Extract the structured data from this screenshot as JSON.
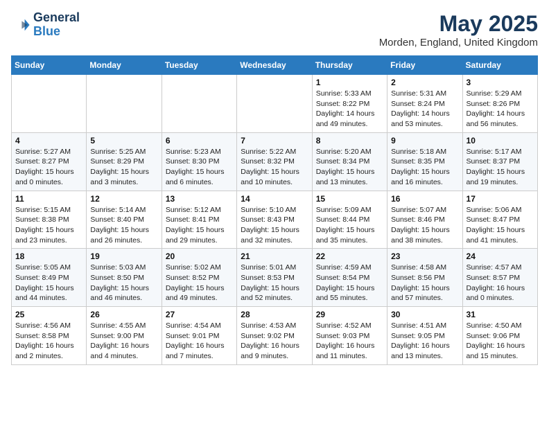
{
  "header": {
    "logo_line1": "General",
    "logo_line2": "Blue",
    "month": "May 2025",
    "location": "Morden, England, United Kingdom"
  },
  "weekdays": [
    "Sunday",
    "Monday",
    "Tuesday",
    "Wednesday",
    "Thursday",
    "Friday",
    "Saturday"
  ],
  "weeks": [
    [
      {
        "day": "",
        "info": ""
      },
      {
        "day": "",
        "info": ""
      },
      {
        "day": "",
        "info": ""
      },
      {
        "day": "",
        "info": ""
      },
      {
        "day": "1",
        "info": "Sunrise: 5:33 AM\nSunset: 8:22 PM\nDaylight: 14 hours\nand 49 minutes."
      },
      {
        "day": "2",
        "info": "Sunrise: 5:31 AM\nSunset: 8:24 PM\nDaylight: 14 hours\nand 53 minutes."
      },
      {
        "day": "3",
        "info": "Sunrise: 5:29 AM\nSunset: 8:26 PM\nDaylight: 14 hours\nand 56 minutes."
      }
    ],
    [
      {
        "day": "4",
        "info": "Sunrise: 5:27 AM\nSunset: 8:27 PM\nDaylight: 15 hours\nand 0 minutes."
      },
      {
        "day": "5",
        "info": "Sunrise: 5:25 AM\nSunset: 8:29 PM\nDaylight: 15 hours\nand 3 minutes."
      },
      {
        "day": "6",
        "info": "Sunrise: 5:23 AM\nSunset: 8:30 PM\nDaylight: 15 hours\nand 6 minutes."
      },
      {
        "day": "7",
        "info": "Sunrise: 5:22 AM\nSunset: 8:32 PM\nDaylight: 15 hours\nand 10 minutes."
      },
      {
        "day": "8",
        "info": "Sunrise: 5:20 AM\nSunset: 8:34 PM\nDaylight: 15 hours\nand 13 minutes."
      },
      {
        "day": "9",
        "info": "Sunrise: 5:18 AM\nSunset: 8:35 PM\nDaylight: 15 hours\nand 16 minutes."
      },
      {
        "day": "10",
        "info": "Sunrise: 5:17 AM\nSunset: 8:37 PM\nDaylight: 15 hours\nand 19 minutes."
      }
    ],
    [
      {
        "day": "11",
        "info": "Sunrise: 5:15 AM\nSunset: 8:38 PM\nDaylight: 15 hours\nand 23 minutes."
      },
      {
        "day": "12",
        "info": "Sunrise: 5:14 AM\nSunset: 8:40 PM\nDaylight: 15 hours\nand 26 minutes."
      },
      {
        "day": "13",
        "info": "Sunrise: 5:12 AM\nSunset: 8:41 PM\nDaylight: 15 hours\nand 29 minutes."
      },
      {
        "day": "14",
        "info": "Sunrise: 5:10 AM\nSunset: 8:43 PM\nDaylight: 15 hours\nand 32 minutes."
      },
      {
        "day": "15",
        "info": "Sunrise: 5:09 AM\nSunset: 8:44 PM\nDaylight: 15 hours\nand 35 minutes."
      },
      {
        "day": "16",
        "info": "Sunrise: 5:07 AM\nSunset: 8:46 PM\nDaylight: 15 hours\nand 38 minutes."
      },
      {
        "day": "17",
        "info": "Sunrise: 5:06 AM\nSunset: 8:47 PM\nDaylight: 15 hours\nand 41 minutes."
      }
    ],
    [
      {
        "day": "18",
        "info": "Sunrise: 5:05 AM\nSunset: 8:49 PM\nDaylight: 15 hours\nand 44 minutes."
      },
      {
        "day": "19",
        "info": "Sunrise: 5:03 AM\nSunset: 8:50 PM\nDaylight: 15 hours\nand 46 minutes."
      },
      {
        "day": "20",
        "info": "Sunrise: 5:02 AM\nSunset: 8:52 PM\nDaylight: 15 hours\nand 49 minutes."
      },
      {
        "day": "21",
        "info": "Sunrise: 5:01 AM\nSunset: 8:53 PM\nDaylight: 15 hours\nand 52 minutes."
      },
      {
        "day": "22",
        "info": "Sunrise: 4:59 AM\nSunset: 8:54 PM\nDaylight: 15 hours\nand 55 minutes."
      },
      {
        "day": "23",
        "info": "Sunrise: 4:58 AM\nSunset: 8:56 PM\nDaylight: 15 hours\nand 57 minutes."
      },
      {
        "day": "24",
        "info": "Sunrise: 4:57 AM\nSunset: 8:57 PM\nDaylight: 16 hours\nand 0 minutes."
      }
    ],
    [
      {
        "day": "25",
        "info": "Sunrise: 4:56 AM\nSunset: 8:58 PM\nDaylight: 16 hours\nand 2 minutes."
      },
      {
        "day": "26",
        "info": "Sunrise: 4:55 AM\nSunset: 9:00 PM\nDaylight: 16 hours\nand 4 minutes."
      },
      {
        "day": "27",
        "info": "Sunrise: 4:54 AM\nSunset: 9:01 PM\nDaylight: 16 hours\nand 7 minutes."
      },
      {
        "day": "28",
        "info": "Sunrise: 4:53 AM\nSunset: 9:02 PM\nDaylight: 16 hours\nand 9 minutes."
      },
      {
        "day": "29",
        "info": "Sunrise: 4:52 AM\nSunset: 9:03 PM\nDaylight: 16 hours\nand 11 minutes."
      },
      {
        "day": "30",
        "info": "Sunrise: 4:51 AM\nSunset: 9:05 PM\nDaylight: 16 hours\nand 13 minutes."
      },
      {
        "day": "31",
        "info": "Sunrise: 4:50 AM\nSunset: 9:06 PM\nDaylight: 16 hours\nand 15 minutes."
      }
    ]
  ]
}
